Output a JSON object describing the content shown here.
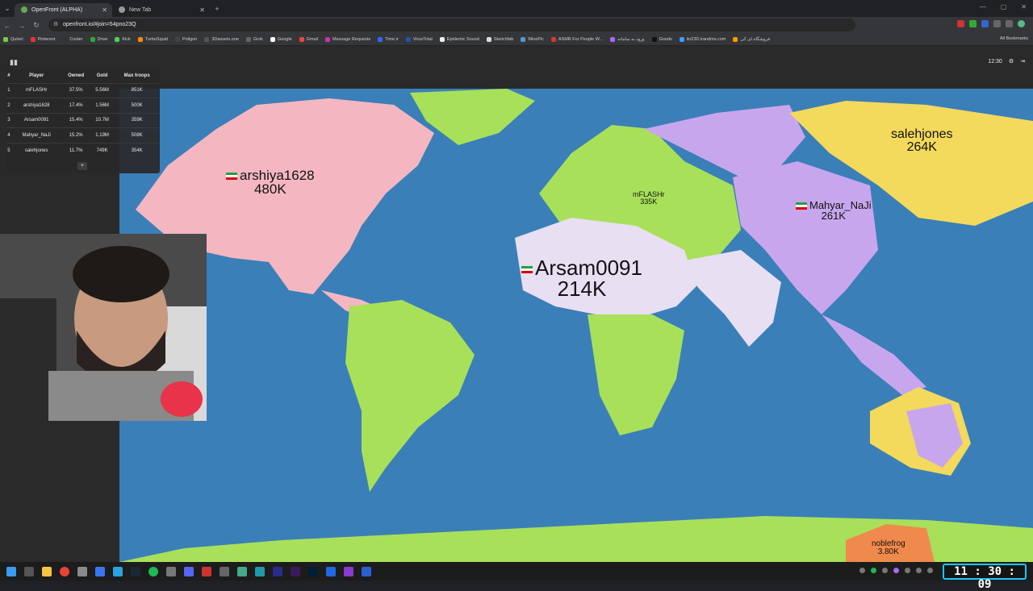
{
  "browser": {
    "tabs": [
      {
        "label": "OpenFront (ALPHA)",
        "active": true
      },
      {
        "label": "New Tab",
        "active": false
      }
    ],
    "url": "openfront.io/#join=54pno23Q",
    "bookmarks": [
      "Quixel",
      "Pinterest",
      "Cooler",
      "Drive",
      "Kick",
      "TurboSquid",
      "Poligon",
      "3Dassets.one",
      "Grok",
      "Google",
      "Gmail",
      "Message Requests",
      "Time.ir",
      "VirusTotal",
      "Epidemic Sound",
      "Sketchfab",
      "MinePic",
      "ASMR For People W...",
      "ورود به سامانه",
      "Goods",
      "iin23D.irandms.com",
      "فروشگاه ای کی"
    ],
    "all_bookmarks": "All Bookmarks"
  },
  "leaderboard": {
    "headers": [
      "#",
      "Player",
      "Owned",
      "Gold",
      "Max troops"
    ],
    "rows": [
      {
        "rank": "1",
        "player": "mFLASHr",
        "owned": "37.5%",
        "gold": "5.56M",
        "troops": "851K"
      },
      {
        "rank": "2",
        "player": "arshiya1628",
        "owned": "17.4%",
        "gold": "1.56M",
        "troops": "500K"
      },
      {
        "rank": "3",
        "player": "Arsam0091",
        "owned": "15.4%",
        "gold": "10.7M",
        "troops": "359K"
      },
      {
        "rank": "4",
        "player": "Mahyar_NaJi",
        "owned": "15.2%",
        "gold": "1.19M",
        "troops": "508K"
      },
      {
        "rank": "5",
        "player": "salehjones",
        "owned": "11.7%",
        "gold": "749K",
        "troops": "354K"
      }
    ],
    "expand": "+"
  },
  "hud": {
    "timer": "12:30"
  },
  "map_labels": {
    "arshiya": {
      "name": "arshiya1628",
      "troops": "480K"
    },
    "mflash": {
      "name": "mFLASHr",
      "troops": "335K"
    },
    "arsam": {
      "name": "Arsam0091",
      "troops": "214K"
    },
    "mahyar": {
      "name": "Mahyar_NaJi",
      "troops": "261K"
    },
    "saleh": {
      "name": "salehjones",
      "troops": "264K"
    },
    "noble": {
      "name": "noblefrog",
      "troops": "3.80K"
    }
  },
  "overlay_clock": "11 : 30 : 09",
  "colors": {
    "ocean": "#3b7fb8",
    "pink": "#f4b7c1",
    "green": "#a8e05a",
    "lavender": "#e8dff3",
    "purple": "#c8a6ee",
    "yellow": "#f3d95c",
    "orange": "#f08a4c"
  }
}
